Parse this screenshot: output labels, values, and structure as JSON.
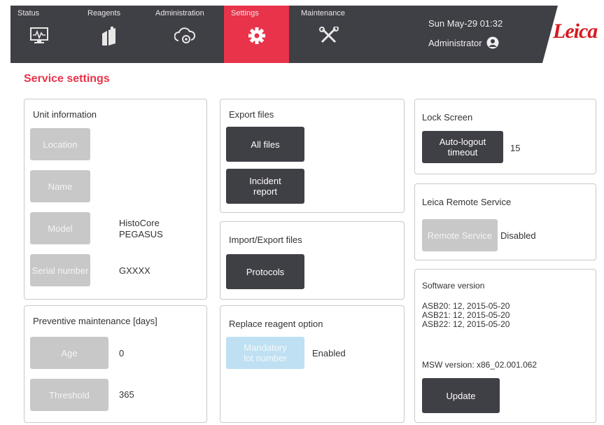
{
  "nav": {
    "tabs": [
      {
        "label": "Status",
        "icon": "status-monitor-icon"
      },
      {
        "label": "Reagents",
        "icon": "reagent-bottles-icon"
      },
      {
        "label": "Administration",
        "icon": "administration-icon"
      },
      {
        "label": "Settings",
        "icon": "gear-icon"
      },
      {
        "label": "Maintenance",
        "icon": "tools-icon"
      }
    ],
    "active_tab": "Settings",
    "active_color": "#e8334a",
    "datetime": "Sun May-29 01:32",
    "user": "Administrator",
    "logo_text": "Leica",
    "logo_color": "#d71920"
  },
  "page": {
    "title": "Service settings"
  },
  "unit_info": {
    "title": "Unit information",
    "location_label": "Location",
    "name_label": "Name",
    "model_label": "Model",
    "model_value_line1": "HistoCore",
    "model_value_line2": "PEGASUS",
    "serial_label": "Serial number",
    "serial_value": "GXXXX"
  },
  "preventive": {
    "title": "Preventive maintenance [days]",
    "age_label": "Age",
    "age_value": "0",
    "threshold_label": "Threshold",
    "threshold_value": "365"
  },
  "export": {
    "title": "Export files",
    "all_files_label": "All files",
    "incident_line1": "Incident",
    "incident_line2": "report"
  },
  "import_export": {
    "title": "Import/Export files",
    "protocols_label": "Protocols"
  },
  "replace_reagent": {
    "title": "Replace reagent option",
    "mandatory_line1": "Mandatory",
    "mandatory_line2": "lot number",
    "status": "Enabled"
  },
  "lock_screen": {
    "title": "Lock Screen",
    "autologout_line1": "Auto-logout",
    "autologout_line2": "timeout",
    "value": "15"
  },
  "remote_service": {
    "title": "Leica Remote Service",
    "button_label": "Remote Service",
    "status": "Disabled"
  },
  "software": {
    "title": "Software version",
    "asb20": "ASB20: 12, 2015-05-20",
    "asb21": "ASB21: 12, 2015-05-20",
    "asb22": "ASB22: 12, 2015-05-20",
    "msw": "MSW version: x86_02.001.062",
    "update_label": "Update"
  }
}
